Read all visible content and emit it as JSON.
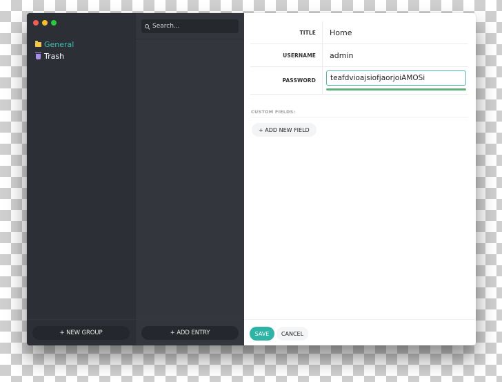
{
  "window": {
    "traffic_lights": [
      "close",
      "minimize",
      "zoom"
    ]
  },
  "groups": {
    "items": [
      {
        "label": "General",
        "icon": "folder-icon",
        "active": true,
        "icon_color": "#f3c94a",
        "label_color": "#3fbdb0"
      },
      {
        "label": "Trash",
        "icon": "trash-icon",
        "active": false,
        "icon_color": "#a98ee8",
        "label_color": "#ffffff"
      }
    ],
    "new_group_label": "+ NEW GROUP"
  },
  "entries": {
    "search_placeholder": "Search...",
    "search_value": "",
    "add_entry_label": "+ ADD ENTRY"
  },
  "detail": {
    "fields": {
      "title": {
        "label": "TITLE",
        "value": "Home"
      },
      "username": {
        "label": "USERNAME",
        "value": "admin"
      },
      "password": {
        "label": "PASSWORD",
        "value": "teafdvioajsiofjaorjoiAMOSi",
        "strength_percent": 100
      }
    },
    "custom_fields_label": "CUSTOM FIELDS:",
    "add_new_field_label": "+ ADD NEW FIELD",
    "save_label": "SAVE",
    "cancel_label": "CANCEL"
  },
  "colors": {
    "accent": "#2fb3a4",
    "strength": "#5fad79",
    "sidebar_bg": "#2c2f35",
    "entries_bg": "#33363d"
  }
}
